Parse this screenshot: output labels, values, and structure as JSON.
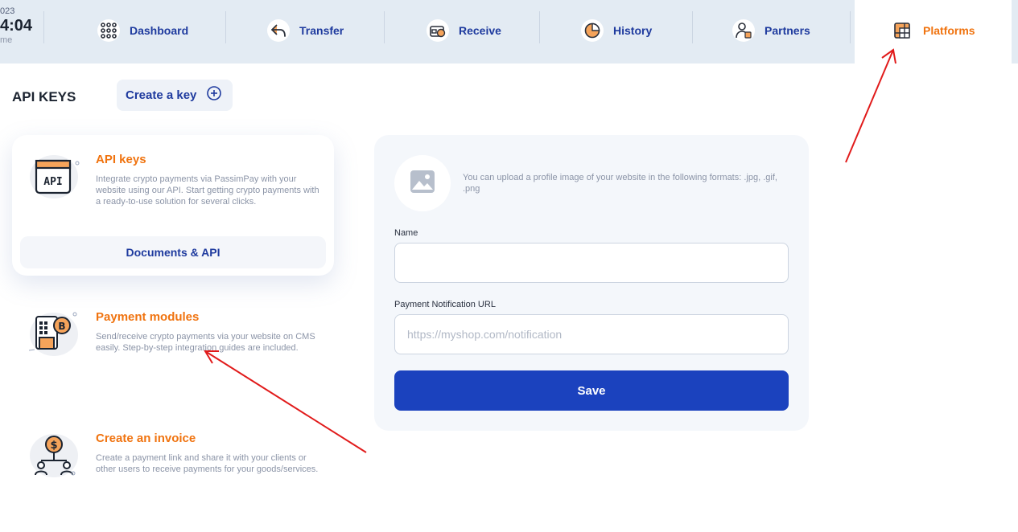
{
  "clock": {
    "year": "023",
    "time": "4:04",
    "label": "me"
  },
  "nav": [
    {
      "label": "Dashboard",
      "icon": "dots-grid-icon"
    },
    {
      "label": "Transfer",
      "icon": "reply-arrow-icon"
    },
    {
      "label": "Receive",
      "icon": "wallet-icon"
    },
    {
      "label": "History",
      "icon": "pie-clock-icon"
    },
    {
      "label": "Partners",
      "icon": "user-card-icon"
    },
    {
      "label": "Platforms",
      "icon": "grid-window-icon",
      "active": true
    }
  ],
  "page": {
    "title": "API KEYS",
    "create_label": "Create a key"
  },
  "cards": [
    {
      "title": "API keys",
      "description": "Integrate crypto payments via PassimPay with your website using our API. Start getting crypto payments with a ready-to-use solution for several clicks.",
      "button": "Documents & API",
      "icon": "api-window-icon"
    },
    {
      "title": "Payment modules",
      "description": "Send/receive crypto payments via your website on CMS easily. Step-by-step integration guides are included.",
      "icon": "payment-module-icon"
    },
    {
      "title": "Create an invoice",
      "description": "Create a payment link and share it with your clients or other users to receive payments for your goods/services.",
      "icon": "invoice-icon"
    }
  ],
  "form": {
    "upload_hint": "You can upload a profile image of your website in the following formats: .jpg, .gif, .png",
    "name_label": "Name",
    "name_value": "",
    "url_label": "Payment Notification URL",
    "url_placeholder": "https://myshop.com/notification",
    "save_label": "Save"
  },
  "colors": {
    "accent": "#f0730f",
    "primary": "#1e3a9e",
    "save_button": "#1b42be",
    "topbar": "#e3ebf3",
    "annotation": "#e11b1b"
  }
}
